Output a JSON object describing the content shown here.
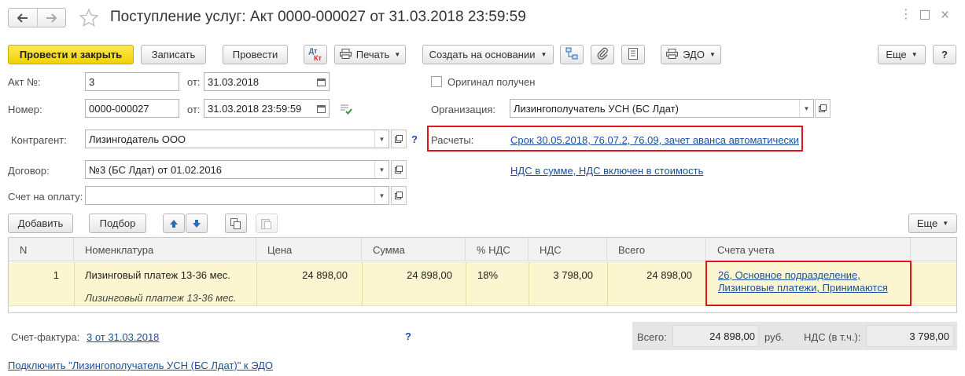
{
  "window": {
    "title": "Поступление услуг: Акт 0000-000027 от 31.03.2018 23:59:59"
  },
  "toolbar": {
    "post_close": "Провести и закрыть",
    "write": "Записать",
    "post": "Провести",
    "dt_kt_top": "Дт",
    "dt_kt_bottom": "Кт",
    "print": "Печать",
    "create_based": "Создать на основании",
    "edo": "ЭДО",
    "more": "Еще",
    "help": "?"
  },
  "form": {
    "act_no_label": "Акт №:",
    "act_no_value": "3",
    "from1_label": "от:",
    "act_date": "31.03.2018",
    "original_label": "Оригинал получен",
    "number_label": "Номер:",
    "number_value": "0000-000027",
    "from2_label": "от:",
    "doc_datetime": "31.03.2018 23:59:59",
    "org_label": "Организация:",
    "org_value": "Лизингополучатель УСН (БС Лдат)",
    "counterparty_label": "Контрагент:",
    "counterparty_value": "Лизингодатель ООО",
    "counterparty_help": "?",
    "settlements_label": "Расчеты:",
    "settlements_link": "Срок 30.05.2018, 76.07.2, 76.09, зачет аванса автоматически",
    "contract_label": "Договор:",
    "contract_value": "№3 (БС Лдат) от 01.02.2016",
    "vat_link": "НДС в сумме, НДС включен в стоимость",
    "invoice_pay_label": "Счет на оплату:",
    "invoice_pay_value": ""
  },
  "table_toolbar": {
    "add": "Добавить",
    "pick": "Подбор",
    "more": "Еще"
  },
  "table": {
    "headers": [
      "N",
      "Номенклатура",
      "Цена",
      "Сумма",
      "% НДС",
      "НДС",
      "Всего",
      "Счета учета"
    ],
    "rows": [
      {
        "n": "1",
        "item": "Лизинговый платеж 13-36 мес.",
        "item_content": "Лизинговый платеж 13-36 мес.",
        "price": "24 898,00",
        "sum": "24 898,00",
        "vat_rate": "18%",
        "vat": "3 798,00",
        "total": "24 898,00",
        "accounts_line1": "26, Основное подразделение,",
        "accounts_line2": "Лизинговые платежи, Принимаются"
      }
    ]
  },
  "footer": {
    "invoice_label": "Счет-фактура:",
    "invoice_link": "3 от 31.03.2018",
    "invoice_help": "?",
    "total_label": "Всего:",
    "total_value": "24 898,00",
    "currency": "руб.",
    "vat_incl_label": "НДС (в т.ч.):",
    "vat_value": "3 798,00",
    "edo_connect_link": "Подключить \"Лизингополучатель УСН (БС Лдат)\" к ЭДО"
  },
  "colors": {
    "accent_primary": "#f5d80f",
    "link": "#1c4fa1",
    "highlight_border": "#e0141c",
    "selected_row": "#fbf6cf"
  }
}
